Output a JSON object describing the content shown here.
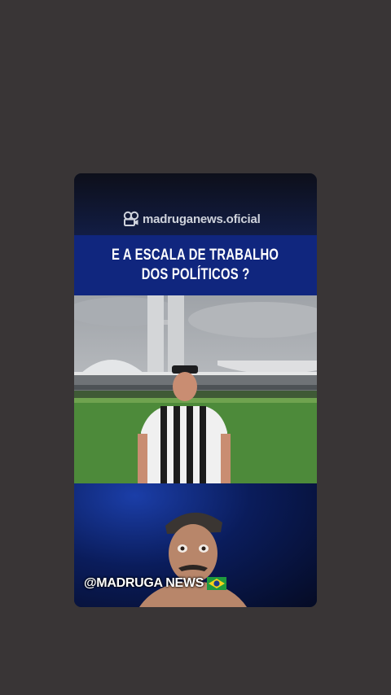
{
  "channel": {
    "name": "madruganews.oficial",
    "icon": "film-reel-icon"
  },
  "headline": {
    "line1": "E A ESCALA DE TRABALHO",
    "line2": "DOS POLÍTICOS ?"
  },
  "footer": {
    "handle": "@MADRUGA NEWS",
    "flag_icon": "brazil-flag-icon"
  },
  "colors": {
    "background": "#393536",
    "headline_band": "#10267e",
    "accent_blue": "#1b3ea8"
  }
}
